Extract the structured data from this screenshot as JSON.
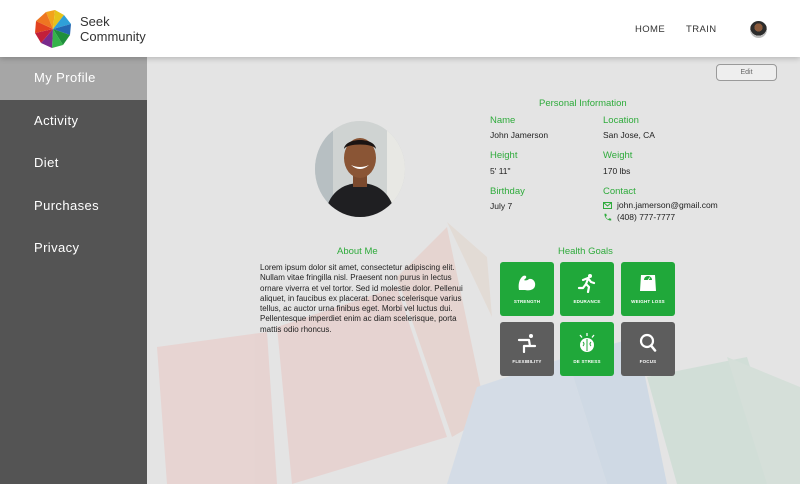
{
  "brand": {
    "line1": "Seek",
    "line2": "Community"
  },
  "nav": {
    "home": "HOME",
    "train": "TRAIN"
  },
  "sidebar": {
    "items": [
      {
        "label": "My Profile",
        "active": true
      },
      {
        "label": "Activity"
      },
      {
        "label": "Diet"
      },
      {
        "label": "Purchases"
      },
      {
        "label": "Privacy"
      }
    ]
  },
  "edit_label": "Edit",
  "personal_info": {
    "title": "Personal Information",
    "name_label": "Name",
    "name": "John Jamerson",
    "location_label": "Location",
    "location": "San Jose, CA",
    "height_label": "Height",
    "height": "5' 11\"",
    "weight_label": "Weight",
    "weight": "170 lbs",
    "birthday_label": "Birthday",
    "birthday": "July 7",
    "contact_label": "Contact",
    "email": "john.jamerson@gmail.com",
    "phone": "(408) 777-7777"
  },
  "about": {
    "title": "About Me",
    "text": "Lorem ipsum dolor sit amet, consectetur adipiscing elit. Nullam vitae fringilla nisl. Praesent non purus in lectus ornare viverra et vel tortor. Sed id molestie dolor. Pellenui aliquet, in faucibus ex placerat. Donec scelerisque varius tellus, ac auctor urna finibus eget. Morbi vel luctus dui. Pellentesque imperdiet enim ac diam scelerisque, porta mattis odio rhoncus."
  },
  "health_goals": {
    "title": "Health Goals",
    "items": [
      {
        "label": "STRENGTH",
        "icon": "flexed-arm-icon",
        "selected": true
      },
      {
        "label": "EDURANCE",
        "icon": "runner-icon",
        "selected": true
      },
      {
        "label": "WEIGHT LOSS",
        "icon": "scale-icon",
        "selected": true
      },
      {
        "label": "FLEXIBILITY",
        "icon": "stretch-icon",
        "selected": false
      },
      {
        "label": "DE STRESS",
        "icon": "brain-icon",
        "selected": true
      },
      {
        "label": "FOCUS",
        "icon": "magnifier-icon",
        "selected": false
      }
    ]
  },
  "colors": {
    "accent": "#2fab3c",
    "tile_on": "#20a83a",
    "tile_off": "#5d5d5d",
    "sidebar": "#545454",
    "sidebar_active": "#a6a6a6"
  }
}
